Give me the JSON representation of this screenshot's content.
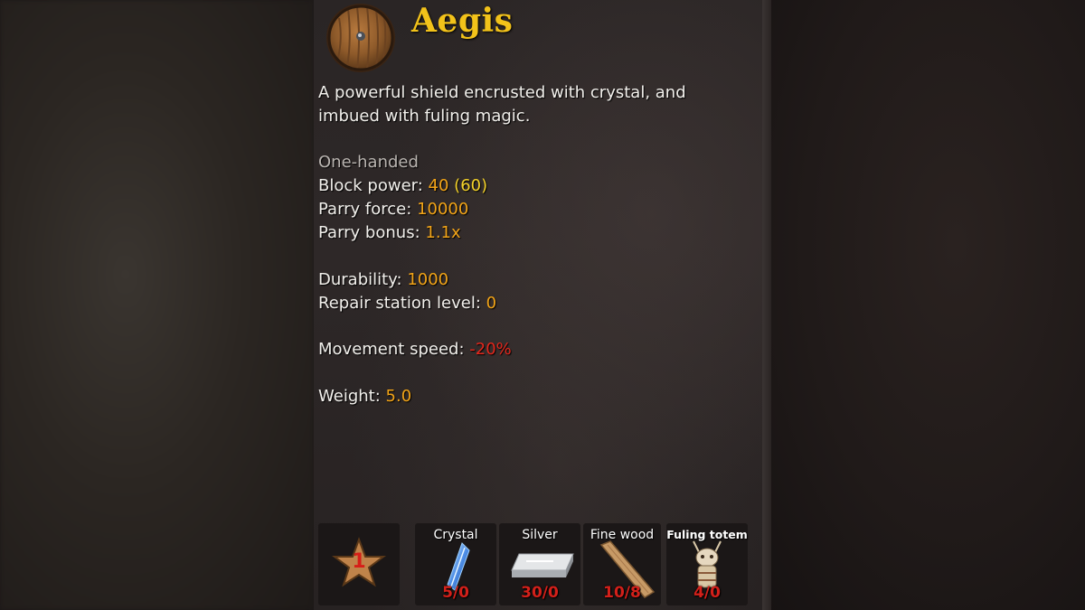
{
  "item": {
    "name": "Aegis",
    "icon": "round-wooden-shield-icon",
    "description": "A powerful shield encrusted with crystal, and imbued with fuling magic."
  },
  "stats": {
    "handedness": "One-handed",
    "block_power_label": "Block power:",
    "block_power_value": "40",
    "block_power_upgraded": "(60)",
    "parry_force_label": "Parry force:",
    "parry_force_value": "10000",
    "parry_bonus_label": "Parry bonus:",
    "parry_bonus_value": "1.1x",
    "durability_label": "Durability:",
    "durability_value": "1000",
    "repair_label": "Repair station level:",
    "repair_value": "0",
    "movement_label": "Movement speed:",
    "movement_value": "-20%",
    "weight_label": "Weight:",
    "weight_value": "5.0"
  },
  "quality": {
    "level": "1",
    "icon": "star-icon"
  },
  "requirements": [
    {
      "name": "Crystal",
      "count": "5/0",
      "icon": "crystal-icon"
    },
    {
      "name": "Silver",
      "count": "30/0",
      "icon": "silver-bar-icon"
    },
    {
      "name": "Fine wood",
      "count": "10/8",
      "icon": "fine-wood-icon"
    },
    {
      "name": "Fuling totem",
      "count": "4/0",
      "icon": "fuling-totem-icon"
    }
  ],
  "colors": {
    "title": "#f2c21a",
    "stat_value": "#f2a418",
    "upgraded_value": "#f4d22a",
    "negative_value": "#e3271c",
    "count_red": "#d3201a"
  }
}
